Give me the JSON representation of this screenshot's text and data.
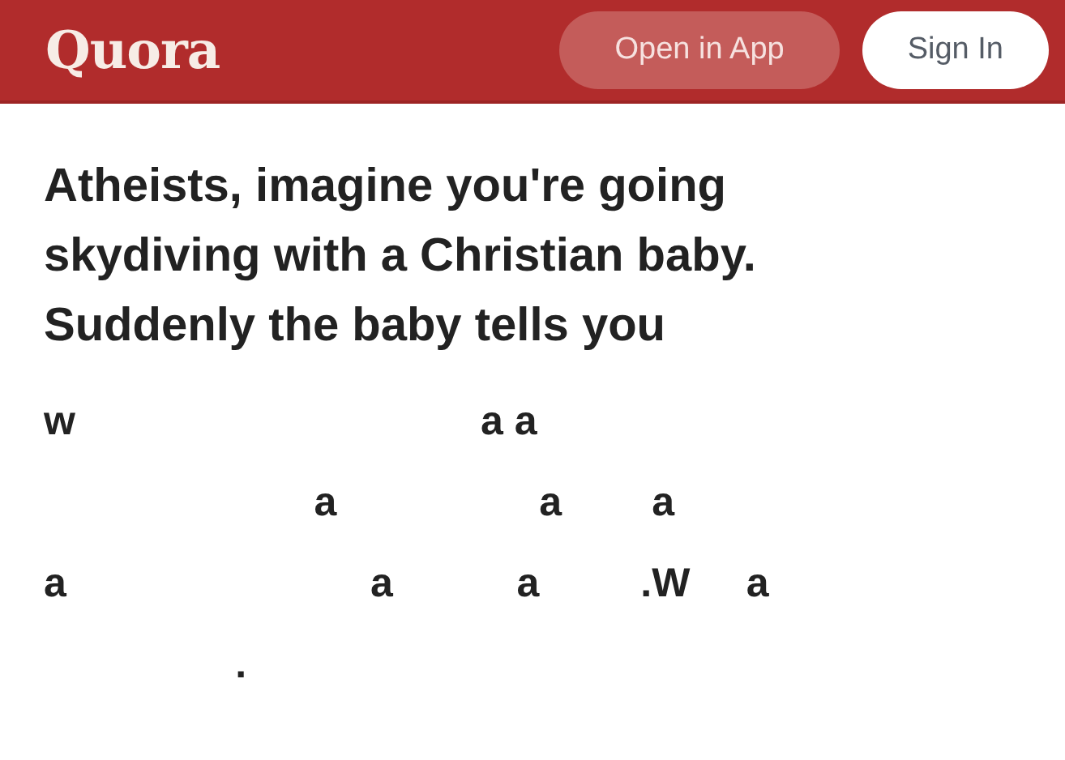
{
  "header": {
    "logo": "Quora",
    "buttons": [
      {
        "label": "Open in App",
        "kind": "secondary"
      },
      {
        "label": "Sign In",
        "kind": "primary"
      }
    ]
  },
  "question": "Atheists, imagine you're going skydiving with a Christian baby. Suddenly the baby tells you",
  "answer_lines": [
    "w                                    a a",
    "                        a                  a        a",
    "a                           a           a         .W     a",
    "                 ."
  ]
}
